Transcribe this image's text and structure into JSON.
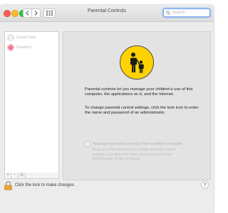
{
  "window": {
    "title": "Parental Controls"
  },
  "search": {
    "placeholder": "Search"
  },
  "sidebar": {
    "users": [
      {
        "label": "Guest User"
      },
      {
        "label": "Random"
      }
    ],
    "add_label": "+",
    "remove_label": "−",
    "options_label": "⚙"
  },
  "main": {
    "description1": "Parental controls let you manage your children's use of this computer, the applications on it, and the Internet.",
    "description2": "To change parental control settings, click the lock icon to enter the name and password of an administrator.",
    "manage_label": "Manage parental controls from another computer",
    "manage_sublabel": "To access this computer to change parental control settings, you need the name and password of an administrator of this computer.",
    "manage_checked": false
  },
  "footer": {
    "lock_text": "Click the lock to make changes.",
    "help_label": "?"
  },
  "colors": {
    "accent": "#ffd200",
    "search_focus": "#7aa7f0"
  }
}
